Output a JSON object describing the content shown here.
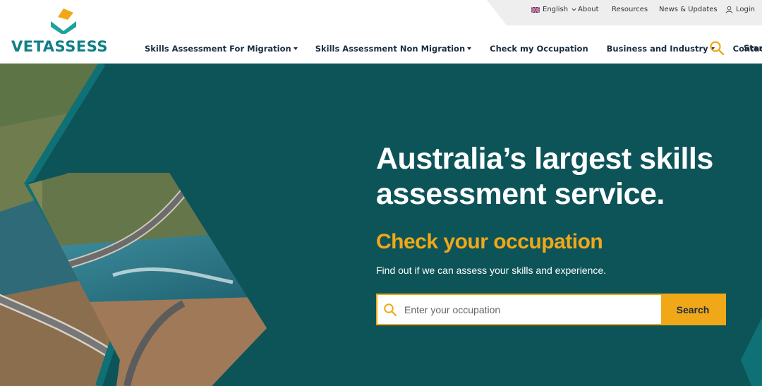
{
  "utility": {
    "language": "English",
    "about": "About",
    "resources": "Resources",
    "news": "News & Updates",
    "login": "Login"
  },
  "brand": {
    "name": "VETASSESS"
  },
  "nav": {
    "items": [
      {
        "label": "Skills Assessment For Migration",
        "dropdown": true
      },
      {
        "label": "Skills Assessment Non Migration",
        "dropdown": true
      },
      {
        "label": "Check my Occupation",
        "dropdown": false
      },
      {
        "label": "Business and Industry",
        "dropdown": true
      },
      {
        "label": "Contact",
        "dropdown": false
      }
    ],
    "start": "Start"
  },
  "hero": {
    "headline_line1": "Australia’s largest skills",
    "headline_line2": "assessment service.",
    "subhead": "Check your occupation",
    "description": "Find out if we can assess your skills and experience.",
    "search_placeholder": "Enter your occupation",
    "search_value": "",
    "search_button": "Search"
  },
  "colors": {
    "teal_dark": "#0d5459",
    "teal_brand": "#0f8086",
    "accent": "#f0a818",
    "nav_text": "#1c2d40"
  },
  "icons": {
    "nav_search": "search-icon",
    "field_search": "search-icon",
    "login": "user-icon",
    "language": "uk-flag-icon"
  }
}
